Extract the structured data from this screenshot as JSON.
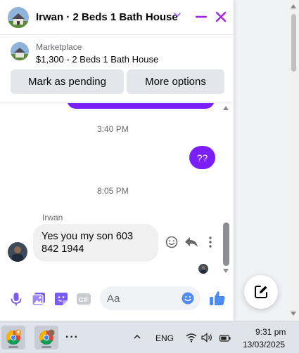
{
  "colors": {
    "accent": "#7a1ffa",
    "messenger_blue": "#0866ff",
    "bubble_gray": "#f0f0f0"
  },
  "header": {
    "title": "Irwan · 2 Beds 1 Bath House",
    "icons": [
      "chevron-down-icon",
      "minimize-icon",
      "close-icon"
    ]
  },
  "listing": {
    "label": "Marketplace",
    "title": "$1,300 - 2 Beds 1 Bath House",
    "buttons": {
      "mark_pending": "Mark as pending",
      "more_options": "More options"
    }
  },
  "messages": {
    "timestamp_1": "3:40 PM",
    "outgoing_text": "??",
    "timestamp_2": "8:05 PM",
    "sender_name": "Irwan",
    "incoming_text": "Yes you my son  603 842 1944",
    "hover_actions": [
      "react-icon",
      "reply-icon",
      "more-icon"
    ]
  },
  "composer": {
    "placeholder": "Aa",
    "icons": [
      "mic-icon",
      "photo-icon",
      "sticker-icon",
      "gif-icon",
      "emoji-icon",
      "like-icon"
    ],
    "gif_label": "GIF"
  },
  "taskbar": {
    "overflow": "···",
    "language": "ENG",
    "time": "9:31 pm",
    "date": "13/03/2025"
  }
}
